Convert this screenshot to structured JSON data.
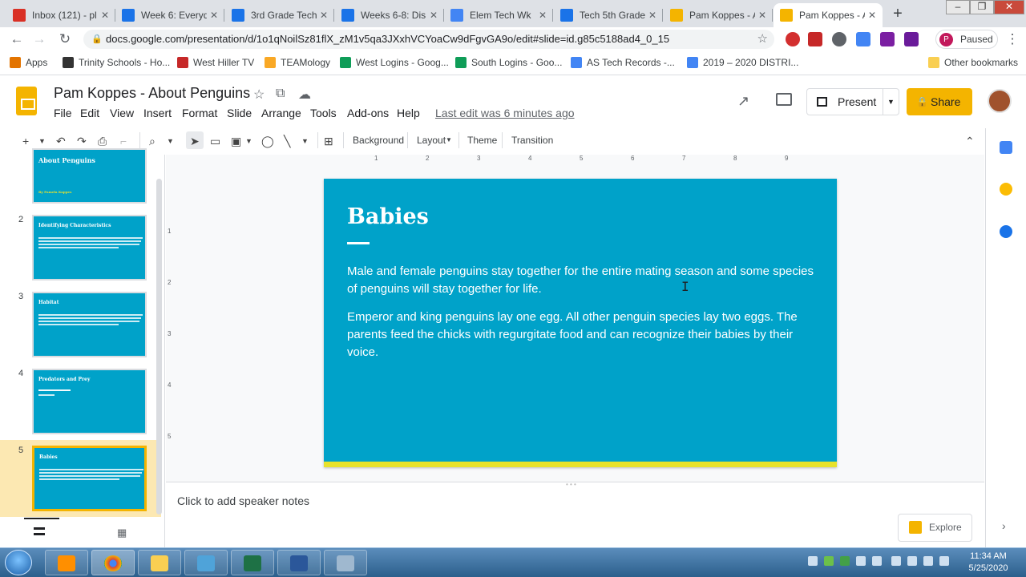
{
  "browser": {
    "tabs": [
      {
        "label": "Inbox (121) - pl",
        "favicon_color": "#d93025",
        "favicon": "gmail-icon"
      },
      {
        "label": "Week 6: Everyd",
        "favicon_color": "#1a73e8",
        "favicon": "classroom-icon"
      },
      {
        "label": "3rd Grade Tech",
        "favicon_color": "#1a73e8",
        "favicon": "classroom-icon"
      },
      {
        "label": "Weeks 6-8: Dis",
        "favicon_color": "#1a73e8",
        "favicon": "classroom-icon"
      },
      {
        "label": "Elem Tech Wk",
        "favicon_color": "#4285f4",
        "favicon": "docs-icon"
      },
      {
        "label": "Tech 5th Grade",
        "favicon_color": "#1a73e8",
        "favicon": "classroom-icon"
      },
      {
        "label": "Pam Koppes - A",
        "favicon_color": "#f4b400",
        "favicon": "slides-icon"
      },
      {
        "label": "Pam Koppes - A",
        "favicon_color": "#f4b400",
        "favicon": "slides-icon"
      }
    ],
    "url": "docs.google.com/presentation/d/1o1qNoilSz81flX_zM1v5qa3JXxhVCYoaCw9dFgvGA9o/edit#slide=id.g85c5188ad4_0_15",
    "profile_label": "Paused",
    "profile_initial": "P",
    "bookmarks": [
      {
        "label": "Apps",
        "color": "#e37400"
      },
      {
        "label": "Trinity Schools - Ho...",
        "color": "#333333"
      },
      {
        "label": "West Hiller TV",
        "color": "#c62828"
      },
      {
        "label": "TEAMology",
        "color": "#f9a825"
      },
      {
        "label": "West Logins - Goog...",
        "color": "#0f9d58"
      },
      {
        "label": "South Logins - Goo...",
        "color": "#0f9d58"
      },
      {
        "label": "AS Tech Records -...",
        "color": "#4285f4"
      },
      {
        "label": "2019 – 2020 DISTRI...",
        "color": "#4285f4"
      }
    ],
    "other_bookmarks": "Other bookmarks"
  },
  "doc": {
    "title": "Pam Koppes - About Penguins",
    "menus": [
      "File",
      "Edit",
      "View",
      "Insert",
      "Format",
      "Slide",
      "Arrange",
      "Tools",
      "Add-ons",
      "Help"
    ],
    "last_edit": "Last edit was 6 minutes ago",
    "present_label": "Present",
    "share_label": "Share"
  },
  "toolbar": {
    "background": "Background",
    "layout": "Layout",
    "theme": "Theme",
    "transition": "Transition"
  },
  "ruler": {
    "h_ticks": [
      "1",
      "2",
      "3",
      "4",
      "5",
      "6",
      "7",
      "8",
      "9"
    ],
    "v_ticks": [
      "1",
      "2",
      "3",
      "4",
      "5"
    ]
  },
  "filmstrip": [
    {
      "num": "",
      "title": "About Penguins",
      "subtitle": "By Pamela Koppes"
    },
    {
      "num": "2",
      "title": "Identifying Characteristics"
    },
    {
      "num": "3",
      "title": "Habitat"
    },
    {
      "num": "4",
      "title": "Predators and Prey"
    },
    {
      "num": "5",
      "title": "Babies"
    }
  ],
  "slide": {
    "title": "Babies",
    "paragraphs": [
      "Male and female penguins stay together for the entire mating season and some species of penguins will stay together for life.",
      "Emperor and king penguins lay one egg.  All other penguin species lay two eggs.  The parents feed the chicks with regurgitate food and can recognize their babies by their voice."
    ],
    "bg_color": "#00a2c9",
    "accent_color": "#e8e22b"
  },
  "notes_placeholder": "Click to add speaker notes",
  "explore_label": "Explore",
  "taskbar": {
    "time": "11:34 AM",
    "date": "5/25/2020"
  }
}
